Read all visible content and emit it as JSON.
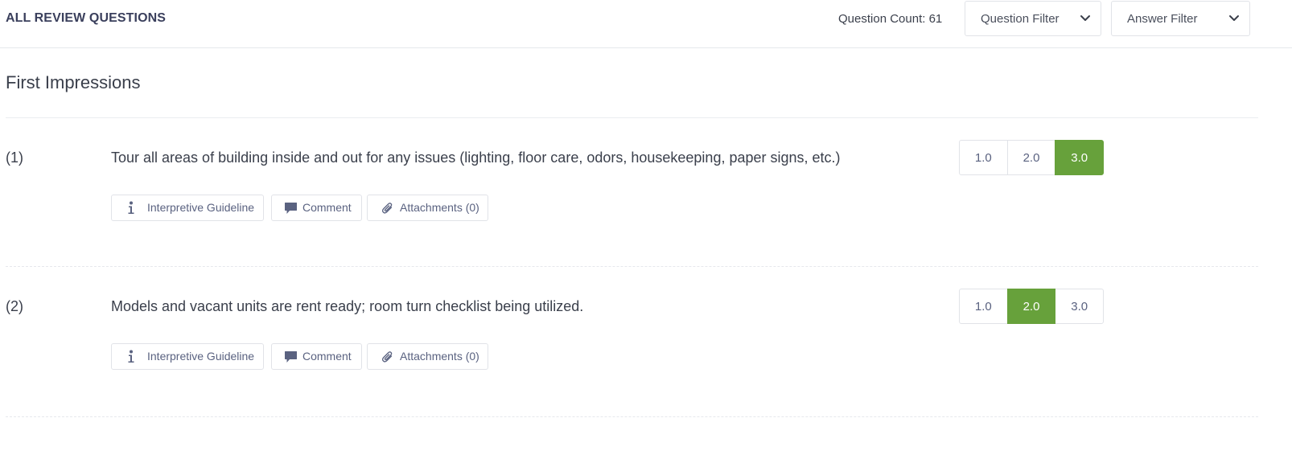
{
  "header": {
    "title": "ALL REVIEW QUESTIONS",
    "question_count": "Question Count: 61",
    "question_filter": "Question Filter",
    "answer_filter": "Answer Filter"
  },
  "section": {
    "title": "First Impressions"
  },
  "questions": [
    {
      "number": "(1)",
      "text": "Tour all areas of building inside and out for any issues (lighting, floor care, odors, housekeeping, paper signs, etc.)",
      "scores": [
        "1.0",
        "2.0",
        "3.0"
      ],
      "selected_score": "3.0",
      "actions": {
        "guideline": "Interpretive Guideline",
        "comment": "Comment",
        "attachments": "Attachments (0)"
      }
    },
    {
      "number": "(2)",
      "text": "Models and vacant units are rent ready; room turn checklist being utilized.",
      "scores": [
        "1.0",
        "2.0",
        "3.0"
      ],
      "selected_score": "2.0",
      "actions": {
        "guideline": "Interpretive Guideline",
        "comment": "Comment",
        "attachments": "Attachments (0)"
      }
    }
  ],
  "colors": {
    "selected_score": "#67a13b",
    "icon": "#5a6280",
    "border": "#e1e3e8"
  },
  "icons": [
    "chevron-down-icon",
    "info-icon",
    "comment-icon",
    "paperclip-icon"
  ]
}
